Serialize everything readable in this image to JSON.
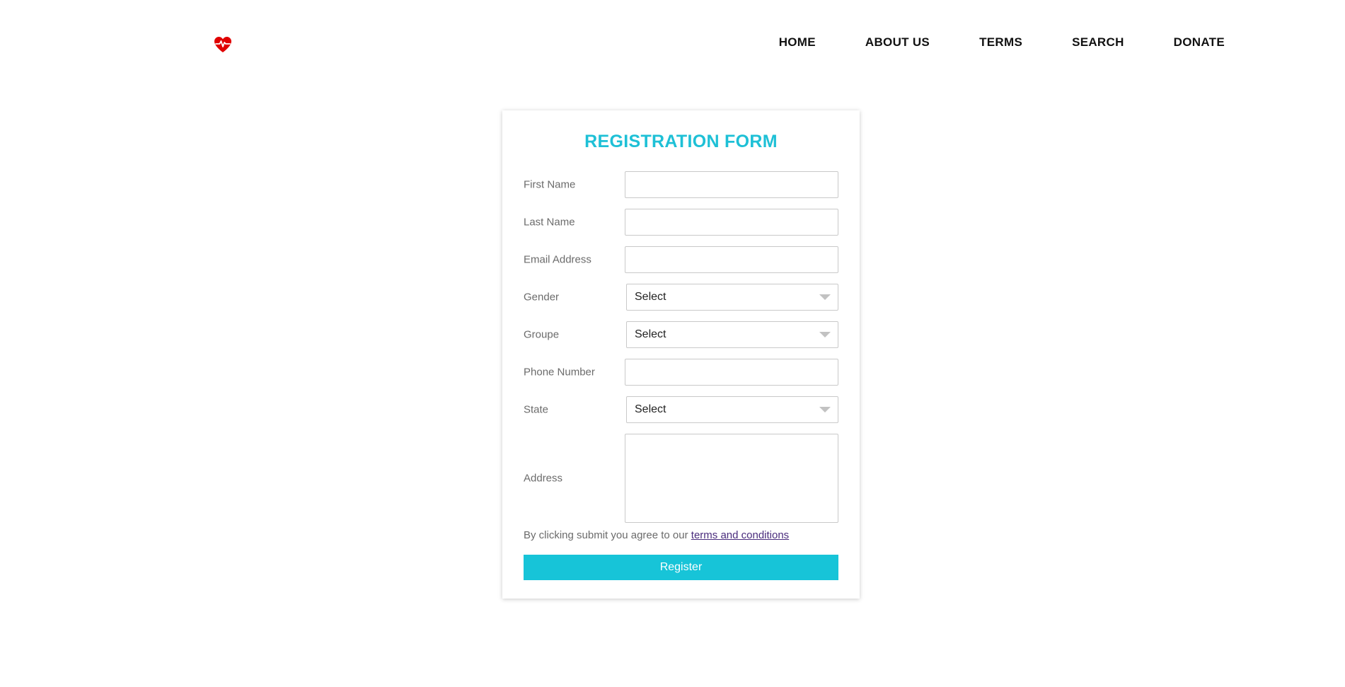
{
  "header": {
    "logo_icon": "heart-pulse-icon",
    "nav": [
      "HOME",
      "ABOUT US",
      "TERMS",
      "SEARCH",
      "DONATE"
    ]
  },
  "form": {
    "title": "REGISTRATION FORM",
    "fields": {
      "first_name": {
        "label": "First Name",
        "value": ""
      },
      "last_name": {
        "label": "Last Name",
        "value": ""
      },
      "email": {
        "label": "Email Address",
        "value": ""
      },
      "gender": {
        "label": "Gender",
        "value": "Select"
      },
      "groupe": {
        "label": "Groupe",
        "value": "Select"
      },
      "phone": {
        "label": "Phone Number",
        "value": ""
      },
      "state": {
        "label": "State",
        "value": "Select"
      },
      "address": {
        "label": "Address",
        "value": ""
      }
    },
    "agree_text": "By clicking submit you agree to our ",
    "terms_link": "terms and conditions",
    "submit_label": "Register"
  },
  "colors": {
    "accent": "#1ec0d6",
    "button": "#17c4d8",
    "logo": "#e00000",
    "link": "#4a2c7d"
  }
}
